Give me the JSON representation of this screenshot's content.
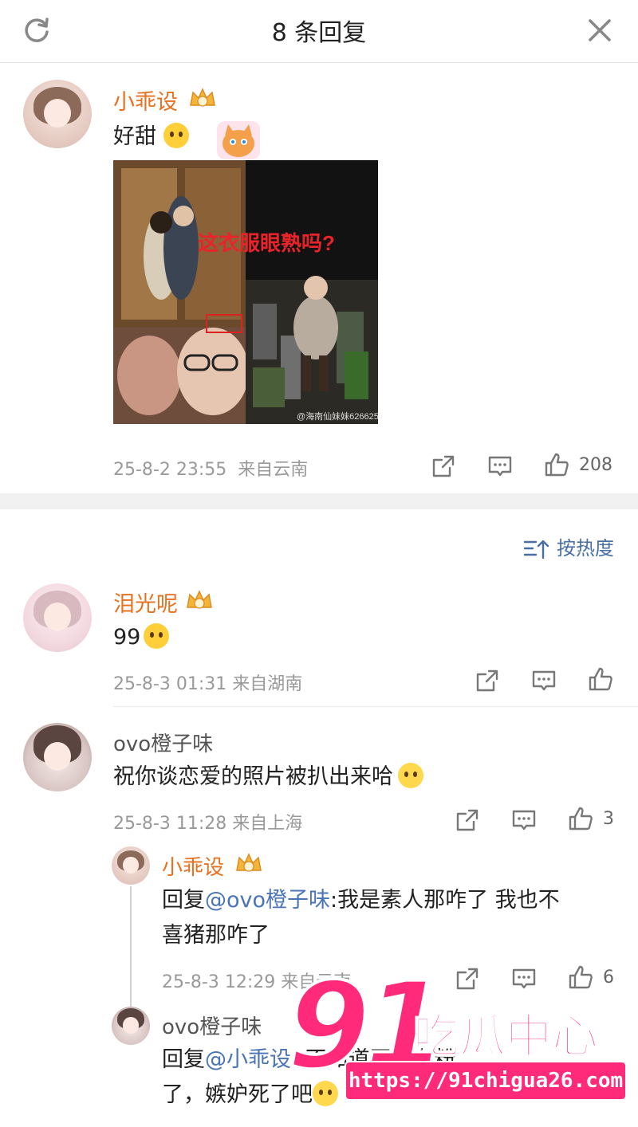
{
  "header": {
    "title": "8 条回复"
  },
  "main_comment": {
    "user": "小乖设",
    "text": "好甜",
    "image_caption": "这衣服眼熟吗?",
    "image_watermark": "@海南仙妹妹626625",
    "time": "25-8-2 23:55",
    "location": "来自云南",
    "likes": "208"
  },
  "sort": {
    "label": "按热度"
  },
  "replies": [
    {
      "user": "泪光呢",
      "text": "99",
      "time": "25-8-3 01:31",
      "location": "来自湖南",
      "likes": ""
    },
    {
      "user": "ovo橙子味",
      "text": "祝你谈恋爱的照片被扒出来哈",
      "time": "25-8-3 11:28",
      "location": "来自上海",
      "likes": "3"
    }
  ],
  "sub_replies": [
    {
      "user": "小乖设",
      "prefix": "回复",
      "mention": "@ovo橙子味",
      "text_line1": ":我是素人那咋了 我也不",
      "text_line2": "喜猪那咋了",
      "time": "25-8-3 12:29",
      "location": "来自云南",
      "likes": "6"
    },
    {
      "user": "ovo橙子味",
      "prefix": "回复",
      "mention": "@小乖设",
      "text_line1": ": 不知道网红有粉",
      "text_line2": "了，嫉妒死了吧"
    }
  ],
  "watermark": {
    "big": "91",
    "cn": "吃瓜中心",
    "url": "https://91chigua26.com"
  }
}
